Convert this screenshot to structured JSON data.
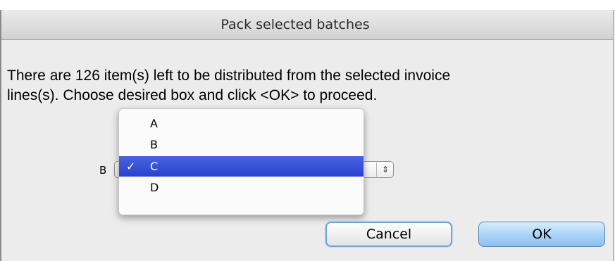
{
  "dialog": {
    "title": "Pack selected batches",
    "message_line1": "There are 126 item(s) left to be distributed from the selected invoice",
    "message_line2": "lines(s). Choose desired box and click <OK> to proceed."
  },
  "box_selector": {
    "label_partial": "B",
    "selected_value": "C",
    "arrows_icon": "up-down-chevron-icon",
    "options": [
      {
        "label": "A",
        "checked": false
      },
      {
        "label": "B",
        "checked": false
      },
      {
        "label": "C",
        "checked": true
      },
      {
        "label": "D",
        "checked": false
      }
    ],
    "check_mark": "✓",
    "highlight_color": "#2f48d5"
  },
  "buttons": {
    "cancel_label": "Cancel",
    "ok_label": "OK"
  }
}
